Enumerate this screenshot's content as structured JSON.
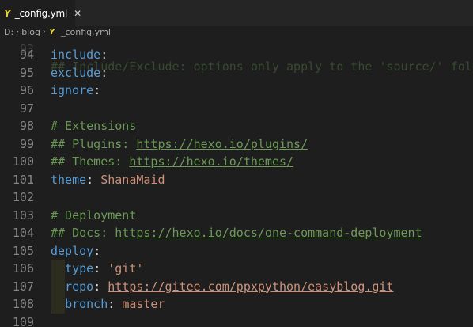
{
  "tab": {
    "icon": "yaml-icon",
    "title": "_config.yml",
    "close": "✕"
  },
  "breadcrumb": {
    "drive": "D:",
    "folder": "blog",
    "file": "_config.yml"
  },
  "editor": {
    "partial_line": {
      "number": "93",
      "text": "## Include/Exclude: options only apply to the 'source/' folder"
    },
    "lines": [
      {
        "number": "94",
        "key": "include",
        "colon": ":"
      },
      {
        "number": "95",
        "key": "exclude",
        "colon": ":"
      },
      {
        "number": "96",
        "key": "ignore",
        "colon": ":"
      },
      {
        "number": "97"
      },
      {
        "number": "98",
        "comment": "# Extensions"
      },
      {
        "number": "99",
        "comment_prefix": "## Plugins: ",
        "comment_link": "https://hexo.io/plugins/"
      },
      {
        "number": "100",
        "comment_prefix": "## Themes: ",
        "comment_link": "https://hexo.io/themes/"
      },
      {
        "number": "101",
        "key": "theme",
        "colon": ": ",
        "value": "ShanaMaid"
      },
      {
        "number": "102"
      },
      {
        "number": "103",
        "comment": "# Deployment"
      },
      {
        "number": "104",
        "comment_prefix": "## Docs: ",
        "comment_link": "https://hexo.io/docs/one-command-deployment"
      },
      {
        "number": "105",
        "key": "deploy",
        "colon": ":"
      },
      {
        "number": "106",
        "indent": "  ",
        "key": "type",
        "colon": ": ",
        "value": "'git'"
      },
      {
        "number": "107",
        "indent": "  ",
        "key": "repo",
        "colon": ": ",
        "link": "https://gitee.com/ppxpython/easyblog.git"
      },
      {
        "number": "108",
        "indent": "  ",
        "key": "bronch",
        "colon": ": ",
        "value": "master"
      },
      {
        "number": "109"
      }
    ]
  },
  "colors": {
    "background": "#1e1e1e",
    "keyword": "#569cd6",
    "comment": "#6a9955",
    "string": "#ce9178",
    "line_number": "#858585"
  }
}
